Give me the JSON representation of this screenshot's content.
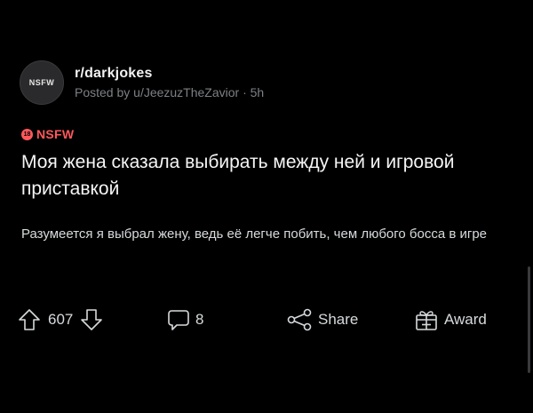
{
  "post": {
    "avatar_text": "NSFW",
    "subreddit": "r/darkjokes",
    "posted_line": "Posted by u/JeezuzTheZavior · 5h",
    "nsfw_badge_number": "18",
    "nsfw_label": "NSFW",
    "title": "Моя жена сказала выбирать между ней и игровой приставкой",
    "body": "Разумеется я выбрал жену, ведь её легче побить, чем любого босса в игре"
  },
  "actions": {
    "vote_count": "607",
    "comment_count": "8",
    "share_label": "Share",
    "award_label": "Award"
  },
  "colors": {
    "background": "#000000",
    "nsfw": "#ff585b",
    "text": "#d7dadc",
    "muted": "#7d8185"
  },
  "icons": [
    "upvote-icon",
    "downvote-icon",
    "comment-icon",
    "share-icon",
    "award-icon"
  ]
}
